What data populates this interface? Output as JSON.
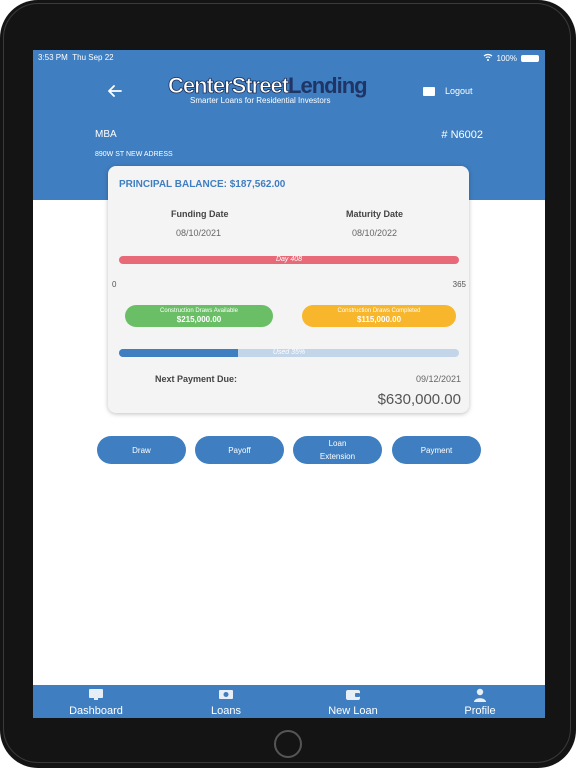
{
  "status_bar": {
    "time": "3:53 PM",
    "date": "Thu Sep 22",
    "battery": "100%"
  },
  "header": {
    "logo_text_1": "CenterStreet",
    "logo_text_2": "Lending",
    "logo_tagline": "Smarter Loans for Residential Investors",
    "logout_label": "Logout",
    "loan_name": "MBA",
    "loan_number": "# N6002",
    "address": "890W ST NEW ADRESS"
  },
  "card": {
    "principal_balance": "PRINCIPAL BALANCE: $187,562.00",
    "funding_label": "Funding Date",
    "funding_date": "08/10/2021",
    "maturity_label": "Maturity Date",
    "maturity_date": "08/10/2022",
    "day_label": "Day 408",
    "tick_start": "0",
    "tick_end": "365",
    "draws_available_label": "Construction Draws Available",
    "draws_available_value": "$215,000.00",
    "draws_completed_label": "Construction Draws Completed",
    "draws_completed_value": "$115,000.00",
    "used_label": "Used 35%",
    "used_fraction": 0.35,
    "next_payment_label": "Next Payment Due:",
    "next_payment_date": "09/12/2021",
    "next_payment_amount": "$630,000.00"
  },
  "actions": {
    "draw": "Draw",
    "payoff": "Payoff",
    "loan_extension_1": "Loan",
    "loan_extension_2": "Extension",
    "payment": "Payment"
  },
  "tabs": {
    "dashboard": "Dashboard",
    "loans": "Loans",
    "new_loan": "New Loan",
    "profile": "Profile"
  },
  "colors": {
    "primary": "#3f7ec0",
    "day_bar": "#e86a78",
    "available": "#6abf66",
    "completed": "#f7b62c"
  }
}
